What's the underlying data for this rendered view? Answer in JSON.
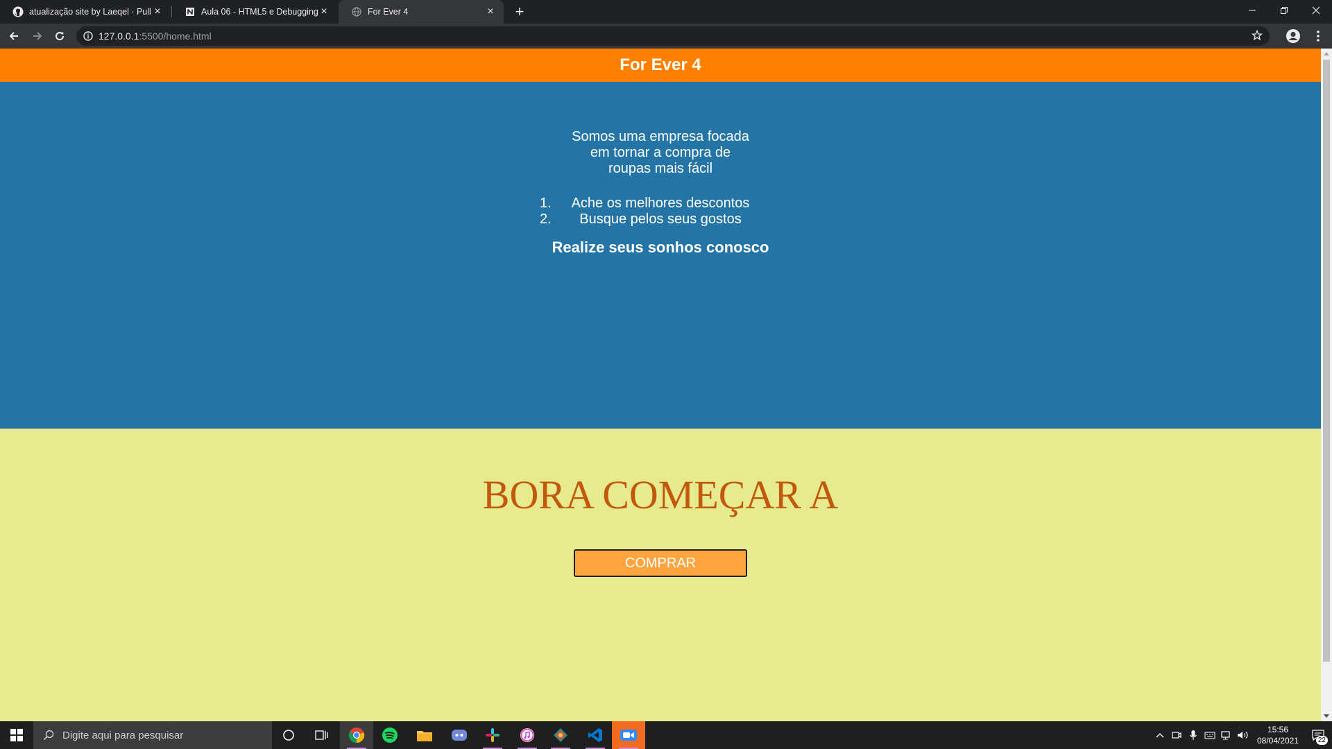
{
  "browser": {
    "tabs": [
      {
        "title": "atualização site by Laeqel · Pull R",
        "icon": "github-icon"
      },
      {
        "title": "Aula 06 - HTML5 e Debugging",
        "icon": "notion-icon"
      },
      {
        "title": "For Ever 4",
        "icon": "globe-icon",
        "active": true
      }
    ],
    "url_host": "127.0.0.1",
    "url_path": ":5500/home.html"
  },
  "page": {
    "header_title": "For Ever 4",
    "intro_lines": [
      "Somos uma empresa focada",
      "em tornar a compra de",
      "roupas mais fácil"
    ],
    "list_items": [
      {
        "num": "1.",
        "text": "Ache os melhores descontos"
      },
      {
        "num": "2.",
        "text": "Busque pelos seus gostos"
      }
    ],
    "tagline": "Realize seus sonhos conosco",
    "cta_heading": "BORA COMEÇAR A",
    "cta_button": "COMPRAR",
    "colors": {
      "header": "#ff8000",
      "hero": "#2475a6",
      "cta_bg": "#e8ea8f",
      "cta_heading": "#c2580c",
      "button": "#ffa53f"
    }
  },
  "taskbar": {
    "search_placeholder": "Digite aqui para pesquisar",
    "apps": [
      "chrome-icon",
      "spotify-icon",
      "file-explorer-icon",
      "discord-icon",
      "slack-icon",
      "itunes-icon",
      "gitkraken-icon",
      "vscode-icon",
      "zoom-icon"
    ],
    "time": "15:56",
    "date": "08/04/2021",
    "notification_count": "22"
  }
}
